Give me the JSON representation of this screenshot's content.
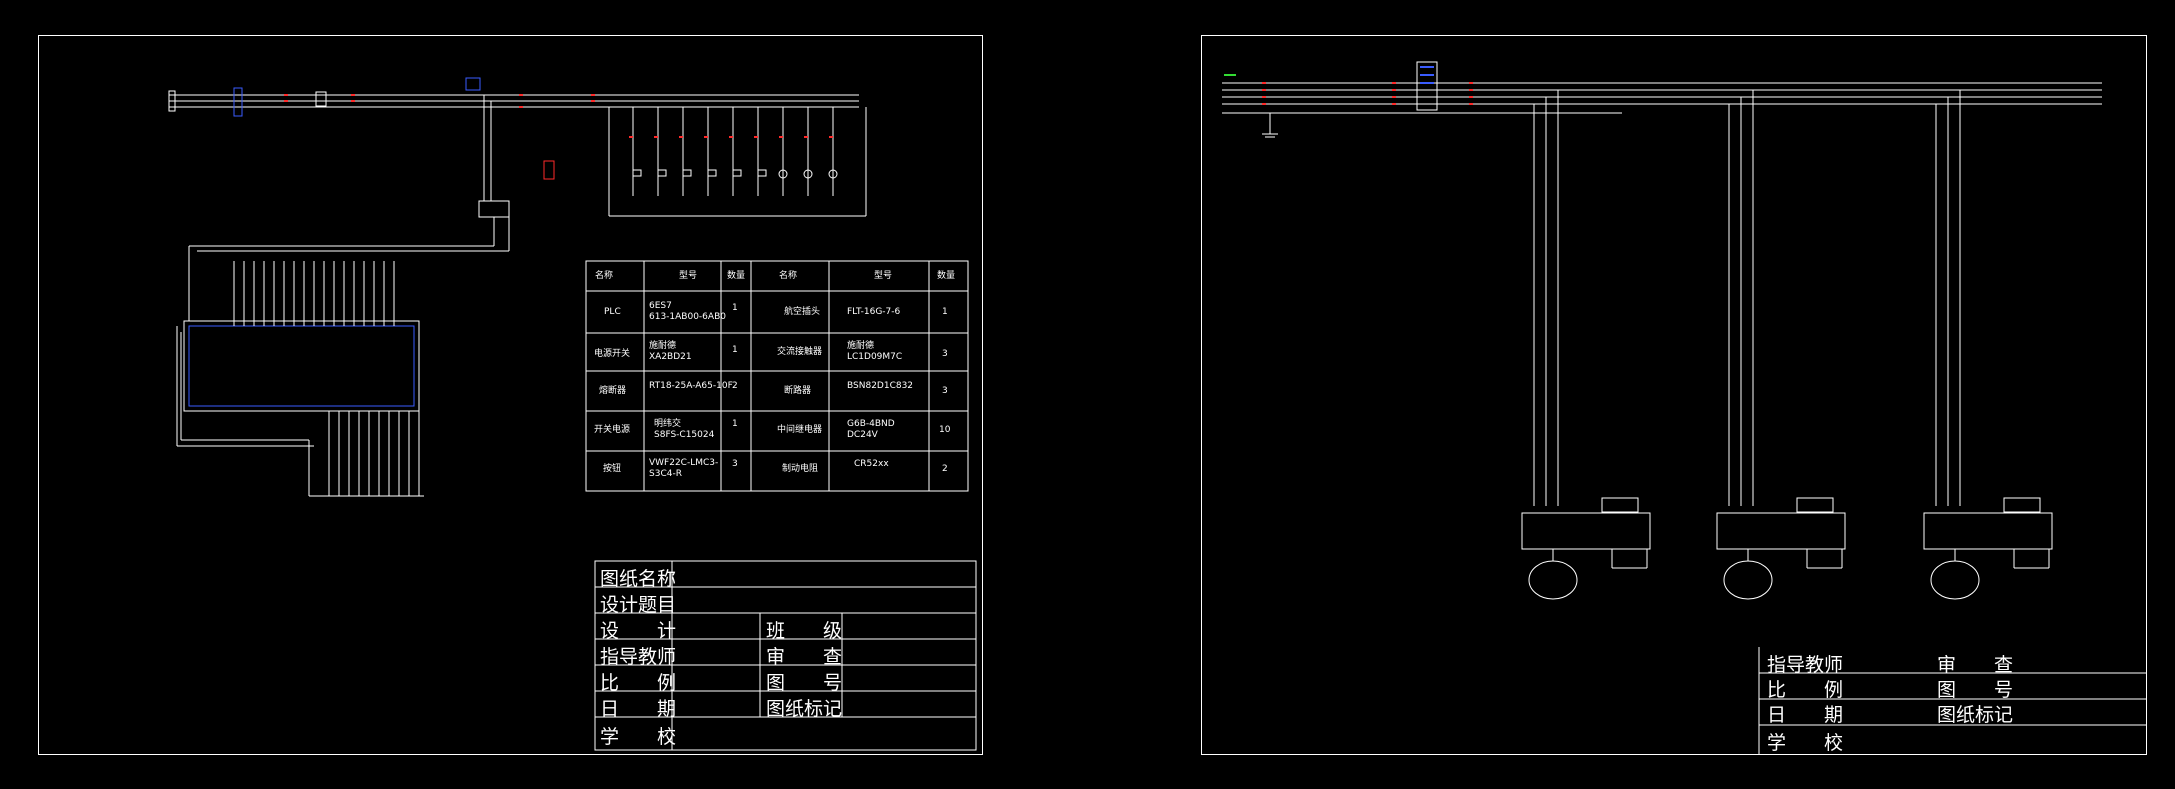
{
  "left_sheet": {
    "parts_table": {
      "headers": [
        "名称",
        "型号",
        "数量",
        "名称",
        "型号",
        "数量"
      ],
      "rows": [
        [
          "PLC",
          "6ES7\n613-1AB00-6AB0",
          "1",
          "航空插头",
          "FLT-16G-7-6",
          "1"
        ],
        [
          "电源开关",
          "施耐德\nXA2BD21",
          "1",
          "交流接触器",
          "施耐德\nLC1D09M7C",
          "3"
        ],
        [
          "熔断器",
          "RT18-25A-A65-10F",
          "2",
          "断路器",
          "BSN82D1C832",
          "3"
        ],
        [
          "开关电源",
          "明纬交\nS8FS-C15024",
          "1",
          "中间继电器",
          "G6B-4BND\nDC24V",
          "10"
        ],
        [
          "按钮",
          "VWF22C-LMC3-\nS3C4-R",
          "3",
          "制动电阻",
          "CR52xx",
          "2"
        ]
      ]
    },
    "title_block": {
      "drawing_name": "图纸名称",
      "design_topic": "设计题目",
      "design": "设　　计",
      "class": "班　　级",
      "advisor": "指导教师",
      "review": "审　　查",
      "scale": "比　　例",
      "drawing_no": "图　　号",
      "date": "日　　期",
      "drawing_mark": "图纸标记",
      "school": "学　　校"
    }
  },
  "right_sheet": {
    "title_block": {
      "advisor": "指导教师",
      "review": "审　　查",
      "scale": "比　　例",
      "drawing_no": "图　　号",
      "date": "日　　期",
      "drawing_mark": "图纸标记",
      "school": "学　　校"
    }
  },
  "colors": {
    "line": "#ffffff",
    "red": "#ff2a2a",
    "blue": "#3a5cff",
    "green": "#33dd33"
  }
}
